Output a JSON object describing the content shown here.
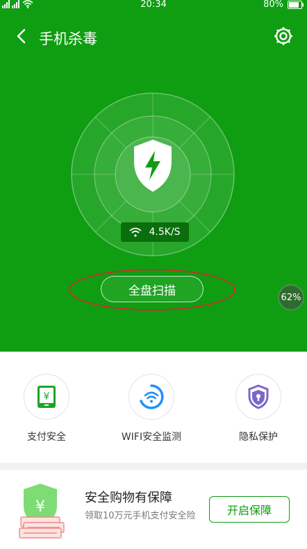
{
  "status_bar": {
    "time": "20:34",
    "battery": "80%"
  },
  "header": {
    "title": "手机杀毒"
  },
  "scanner": {
    "speed": "4.5K/S",
    "scan_button": "全盘扫描",
    "float_percent": "62%"
  },
  "features": [
    {
      "label": "支付安全"
    },
    {
      "label": "WIFI安全监测"
    },
    {
      "label": "隐私保护"
    }
  ],
  "promo": {
    "title": "安全购物有保障",
    "description": "领取10万元手机支付安全险",
    "button": "开启保障"
  },
  "colors": {
    "brand_green": "#0f9d12",
    "annotation_red": "#c9302c",
    "shield_purple": "#7b68c9",
    "wifi_blue": "#1e90ff"
  }
}
